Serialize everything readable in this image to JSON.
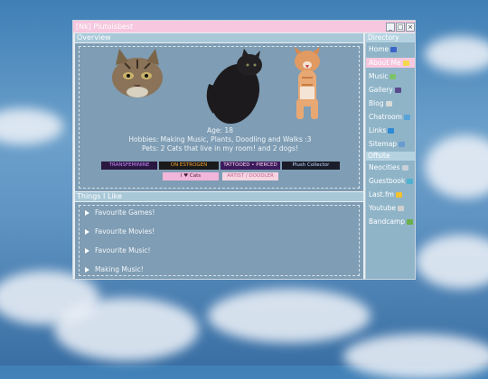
{
  "window": {
    "title": "[Nk] Plutoisbest"
  },
  "overview": {
    "heading": "Overview",
    "age": "Age: 18",
    "hobbies": "Hobbies: Making Music, Plants, Doodling and Walks :3",
    "pets": "Pets: 2 Cats that live in my room! and 2 dogs!",
    "badges": [
      "TRANSFEMININE",
      "ON ESTROGEN",
      "TATTOOED • PIERCED",
      "Plush Collector",
      "I ♥ Cats",
      "ARTIST / DOODLER"
    ]
  },
  "likes": {
    "heading": "Things I Like",
    "items": [
      "Favourite Games!",
      "Favourite Movies!",
      "Favourite Music!",
      "Making Music!"
    ]
  },
  "sidebar": {
    "directory_heading": "Directory",
    "directory": [
      {
        "label": "Home",
        "icon": "home-icon",
        "color": "#3b64c8"
      },
      {
        "label": "About Me",
        "icon": "lightbulb-icon",
        "color": "#f3d84a",
        "active": true
      },
      {
        "label": "Music",
        "icon": "music-icon",
        "color": "#7cc36a"
      },
      {
        "label": "Gallery",
        "icon": "gallery-icon",
        "color": "#5a4a8c"
      },
      {
        "label": "Blog",
        "icon": "blog-icon",
        "color": "#d9d9d9"
      },
      {
        "label": "Chatroom",
        "icon": "chat-icon",
        "color": "#57a3d8"
      },
      {
        "label": "Links",
        "icon": "globe-icon",
        "color": "#2f8ad6"
      },
      {
        "label": "Sitemap",
        "icon": "search-icon",
        "color": "#6a9bd0"
      }
    ],
    "offsite_heading": "Offsite",
    "offsite": [
      {
        "label": "Neocities",
        "icon": "monitor-icon",
        "color": "#c8d0d8"
      },
      {
        "label": "Guestbook",
        "icon": "book-icon",
        "color": "#4fb0d0"
      },
      {
        "label": "Last.fm",
        "icon": "play-icon",
        "color": "#f2c230"
      },
      {
        "label": "Youtube",
        "icon": "video-icon",
        "color": "#cfcfcf"
      },
      {
        "label": "Bandcamp",
        "icon": "bandcamp-icon",
        "color": "#6ab04c"
      }
    ]
  }
}
